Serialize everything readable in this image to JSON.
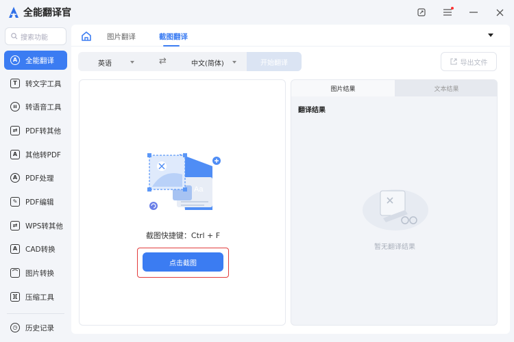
{
  "app": {
    "title": "全能翻译官"
  },
  "window": {
    "controls": [
      "pin-icon",
      "menu-icon",
      "minimize-icon",
      "close-icon"
    ]
  },
  "sidebar": {
    "search_placeholder": "搜索功能",
    "items": [
      {
        "label": "全能翻译",
        "icon": "translate-icon",
        "active": true
      },
      {
        "label": "转文字工具",
        "icon": "text-icon"
      },
      {
        "label": "转语音工具",
        "icon": "audio-icon"
      },
      {
        "label": "PDF转其他",
        "icon": "pdf-convert-icon"
      },
      {
        "label": "其他转PDF",
        "icon": "to-pdf-icon"
      },
      {
        "label": "PDF处理",
        "icon": "pdf-process-icon"
      },
      {
        "label": "PDF编辑",
        "icon": "pdf-edit-icon"
      },
      {
        "label": "WPS转其他",
        "icon": "wps-icon"
      },
      {
        "label": "CAD转换",
        "icon": "cad-icon"
      },
      {
        "label": "图片转换",
        "icon": "image-icon"
      },
      {
        "label": "压缩工具",
        "icon": "compress-icon"
      }
    ],
    "history": "历史记录"
  },
  "tabs": {
    "image_translate": "图片翻译",
    "screenshot_translate": "截图翻译"
  },
  "toolbar": {
    "source_lang": "英语",
    "target_lang": "中文(简体)",
    "start": "开始翻译",
    "export": "导出文件"
  },
  "capture": {
    "shortcut": "截图快捷键：Ctrl + F",
    "button": "点击截图"
  },
  "result": {
    "tab_image": "图片结果",
    "tab_text": "文本结果",
    "heading": "翻译结果",
    "empty": "暂无翻译结果"
  },
  "colors": {
    "accent": "#3b7cf2",
    "highlight": "#e23a3a"
  }
}
